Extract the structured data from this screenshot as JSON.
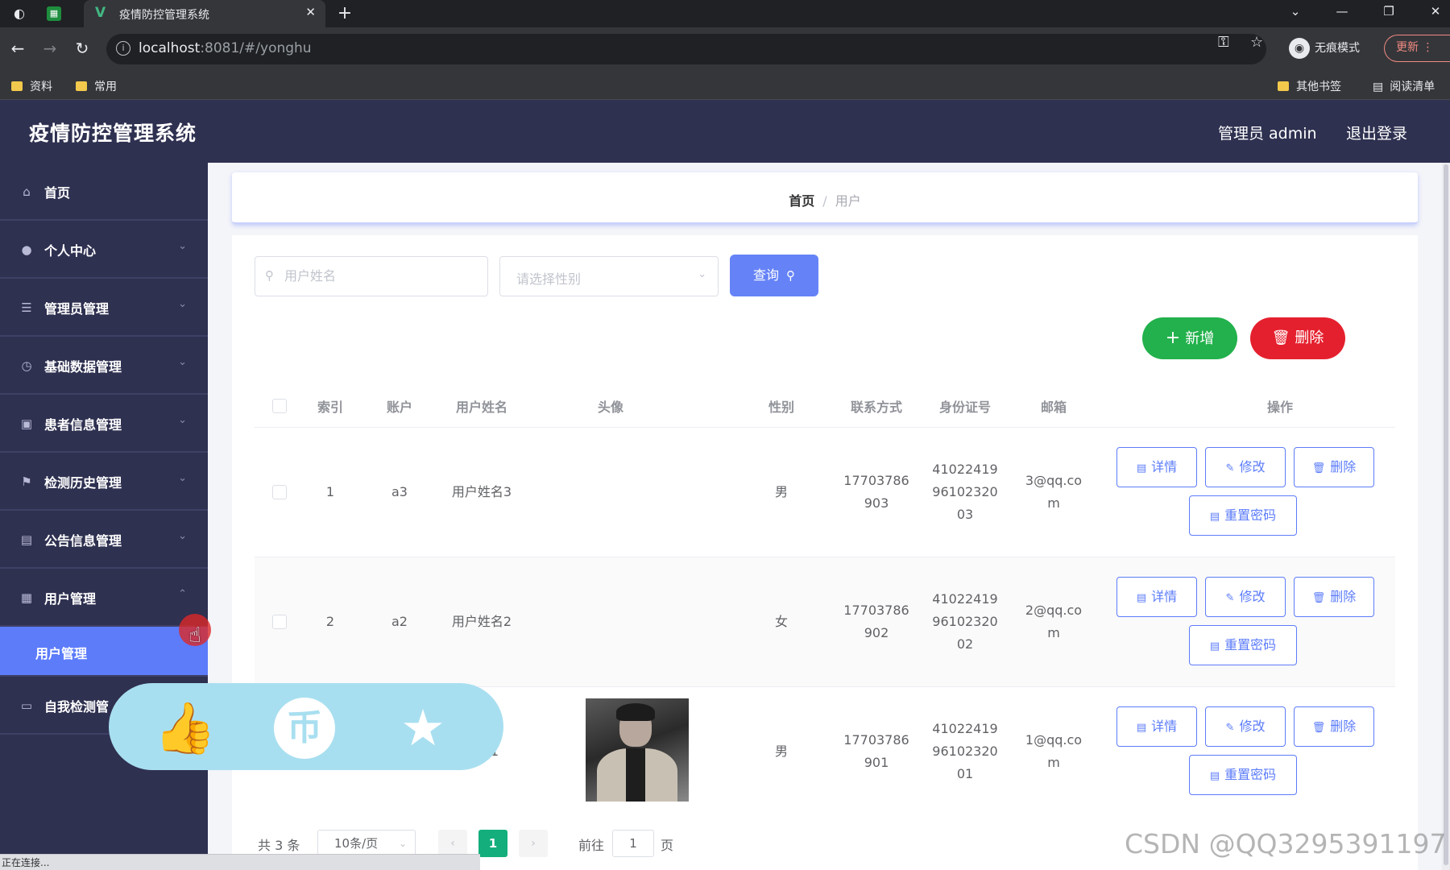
{
  "browser": {
    "tab_title": "疫情防控管理系统",
    "tab_logo": "V",
    "url_host": "localhost",
    "url_rest": ":8081/#/yonghu",
    "incognito_label": "无痕模式",
    "update_label": "更新",
    "bookmarks": [
      "资料",
      "常用"
    ],
    "other_bookmarks": "其他书签",
    "reading_list": "阅读清单",
    "status_text": "正在连接..."
  },
  "header": {
    "app_title": "疫情防控管理系统",
    "user_label": "管理员 admin",
    "logout_label": "退出登录"
  },
  "sidebar": {
    "items": [
      {
        "label": "首页",
        "icon": "home-icon"
      },
      {
        "label": "个人中心",
        "icon": "user-icon"
      },
      {
        "label": "管理员管理",
        "icon": "list-icon"
      },
      {
        "label": "基础数据管理",
        "icon": "clock-icon"
      },
      {
        "label": "患者信息管理",
        "icon": "chart-icon"
      },
      {
        "label": "检测历史管理",
        "icon": "flag-icon"
      },
      {
        "label": "公告信息管理",
        "icon": "document-icon"
      },
      {
        "label": "用户管理",
        "icon": "grid-icon"
      },
      {
        "label": "自我检测管",
        "icon": "chat-icon"
      }
    ],
    "active_sub": "用户管理"
  },
  "breadcrumb": {
    "home": "首页",
    "separator": "/",
    "current": "用户"
  },
  "search": {
    "name_placeholder": "用户姓名",
    "gender_placeholder": "请选择性别",
    "query_label": "查询"
  },
  "actions": {
    "add_label": "新增",
    "delete_label": "删除"
  },
  "table": {
    "headers": {
      "index": "索引",
      "account": "账户",
      "name": "用户姓名",
      "avatar": "头像",
      "gender": "性别",
      "phone": "联系方式",
      "id_number": "身份证号",
      "email": "邮箱",
      "ops": "操作"
    },
    "rows": [
      {
        "index": "1",
        "account": "a3",
        "name": "用户姓名3",
        "gender": "男",
        "phone_lines": [
          "17703786",
          "903"
        ],
        "id_lines": [
          "41022419",
          "96102320",
          "03"
        ],
        "email_lines": [
          "3@qq.co",
          "m"
        ],
        "has_avatar": false
      },
      {
        "index": "2",
        "account": "a2",
        "name": "用户姓名2",
        "gender": "女",
        "phone_lines": [
          "17703786",
          "902"
        ],
        "id_lines": [
          "41022419",
          "96102320",
          "02"
        ],
        "email_lines": [
          "2@qq.co",
          "m"
        ],
        "has_avatar": false
      },
      {
        "index": "",
        "account": "",
        "name": "姓名1",
        "gender": "男",
        "phone_lines": [
          "17703786",
          "901"
        ],
        "id_lines": [
          "41022419",
          "96102320",
          "01"
        ],
        "email_lines": [
          "1@qq.co",
          "m"
        ],
        "has_avatar": true
      }
    ],
    "op_labels": {
      "detail": "详情",
      "edit": "修改",
      "delete": "删除",
      "reset": "重置密码"
    }
  },
  "pagination": {
    "total": "共 3 条",
    "page_size": "10条/页",
    "current_page": "1",
    "goto_label": "前往",
    "goto_value": "1",
    "page_suffix": "页"
  },
  "watermark": "CSDN @QQ3295391197",
  "colors": {
    "sidebar_bg": "#2f3151",
    "accent": "#5c7cfa",
    "add_button": "#22b14c",
    "delete_button": "#e5202e",
    "pagination_active": "#13ae7c"
  }
}
